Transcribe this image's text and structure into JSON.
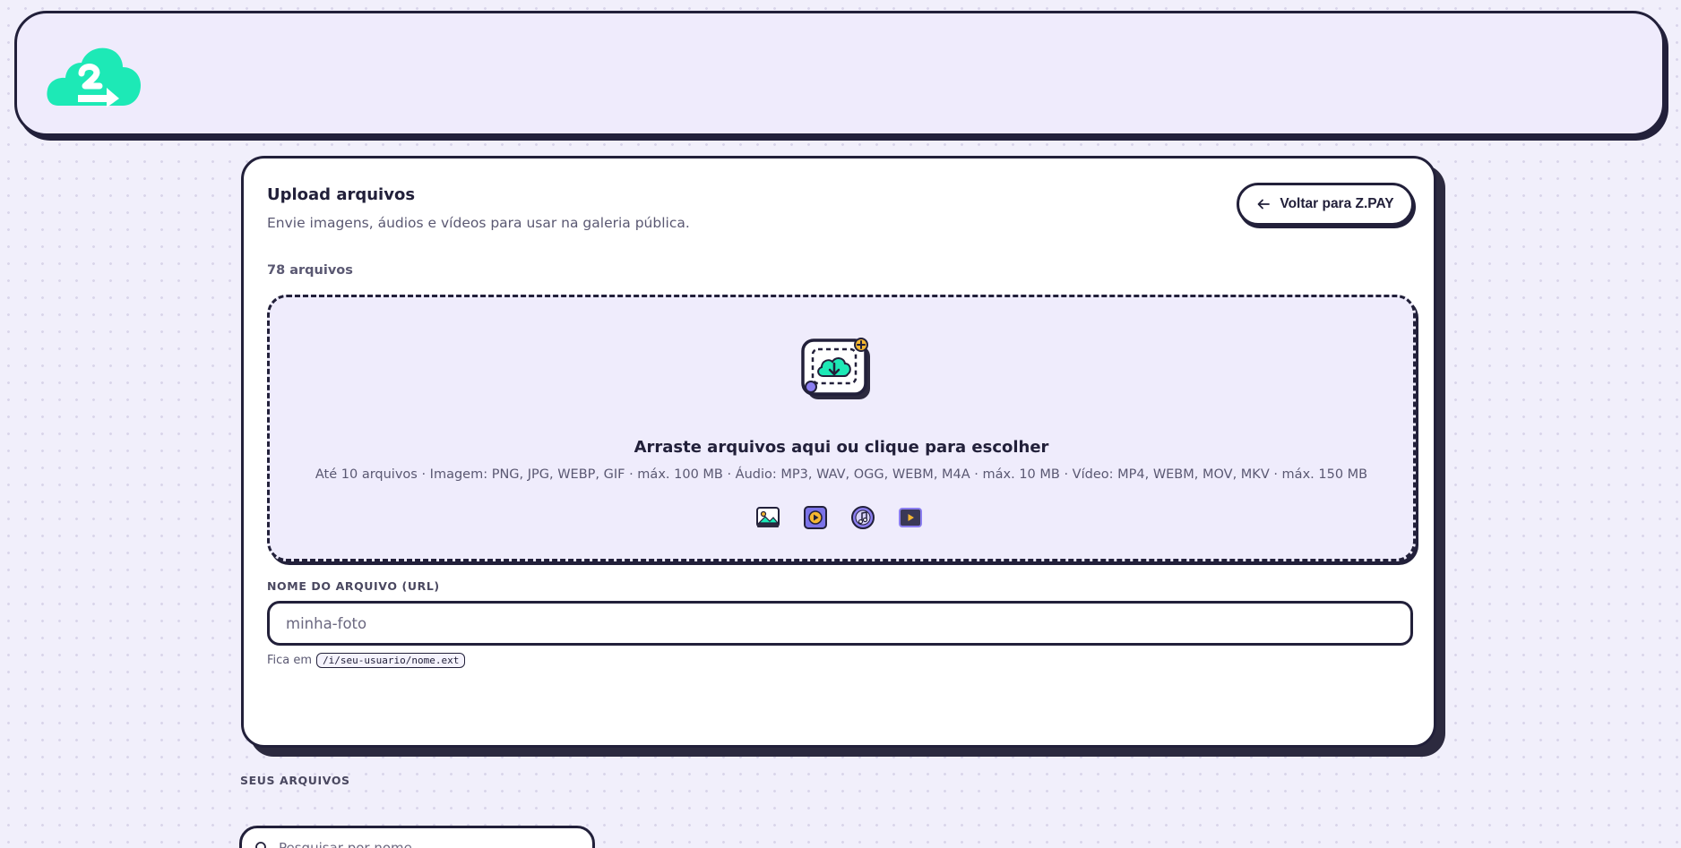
{
  "header": {
    "logo_icon": "cloud-share-logo"
  },
  "upload": {
    "title": "Upload arquivos",
    "subtitle": "Envie imagens, áudios e vídeos para usar na galeria pública.",
    "count": "78 arquivos",
    "back_label": "Voltar para Z.PAY",
    "dropzone": {
      "title": "Arraste arquivos aqui ou clique para escolher",
      "hint": "Até 10 arquivos · Imagem: PNG, JPG, WEBP, GIF · máx. 100 MB · Áudio: MP3, WAV, OGG, WEBM, M4A · máx. 10 MB · Vídeo: MP4, WEBM, MOV, MKV · máx. 150 MB",
      "type_icons": [
        "image-icon",
        "play-icon",
        "music-note-icon",
        "video-icon"
      ]
    },
    "filename": {
      "label": "NOME DO ARQUIVO (URL)",
      "placeholder": "minha-foto",
      "help_prefix": "Fica em",
      "help_code": "/i/seu-usuario/nome.ext"
    }
  },
  "files": {
    "section_label": "SEUS ARQUIVOS",
    "search_placeholder": "Pesquisar por nome"
  },
  "colors": {
    "accent": "#1de9b6",
    "ink": "#22203a",
    "background": "#f1effb",
    "dropzone_bg": "#efecfc",
    "purple": "#8b7ef0"
  }
}
